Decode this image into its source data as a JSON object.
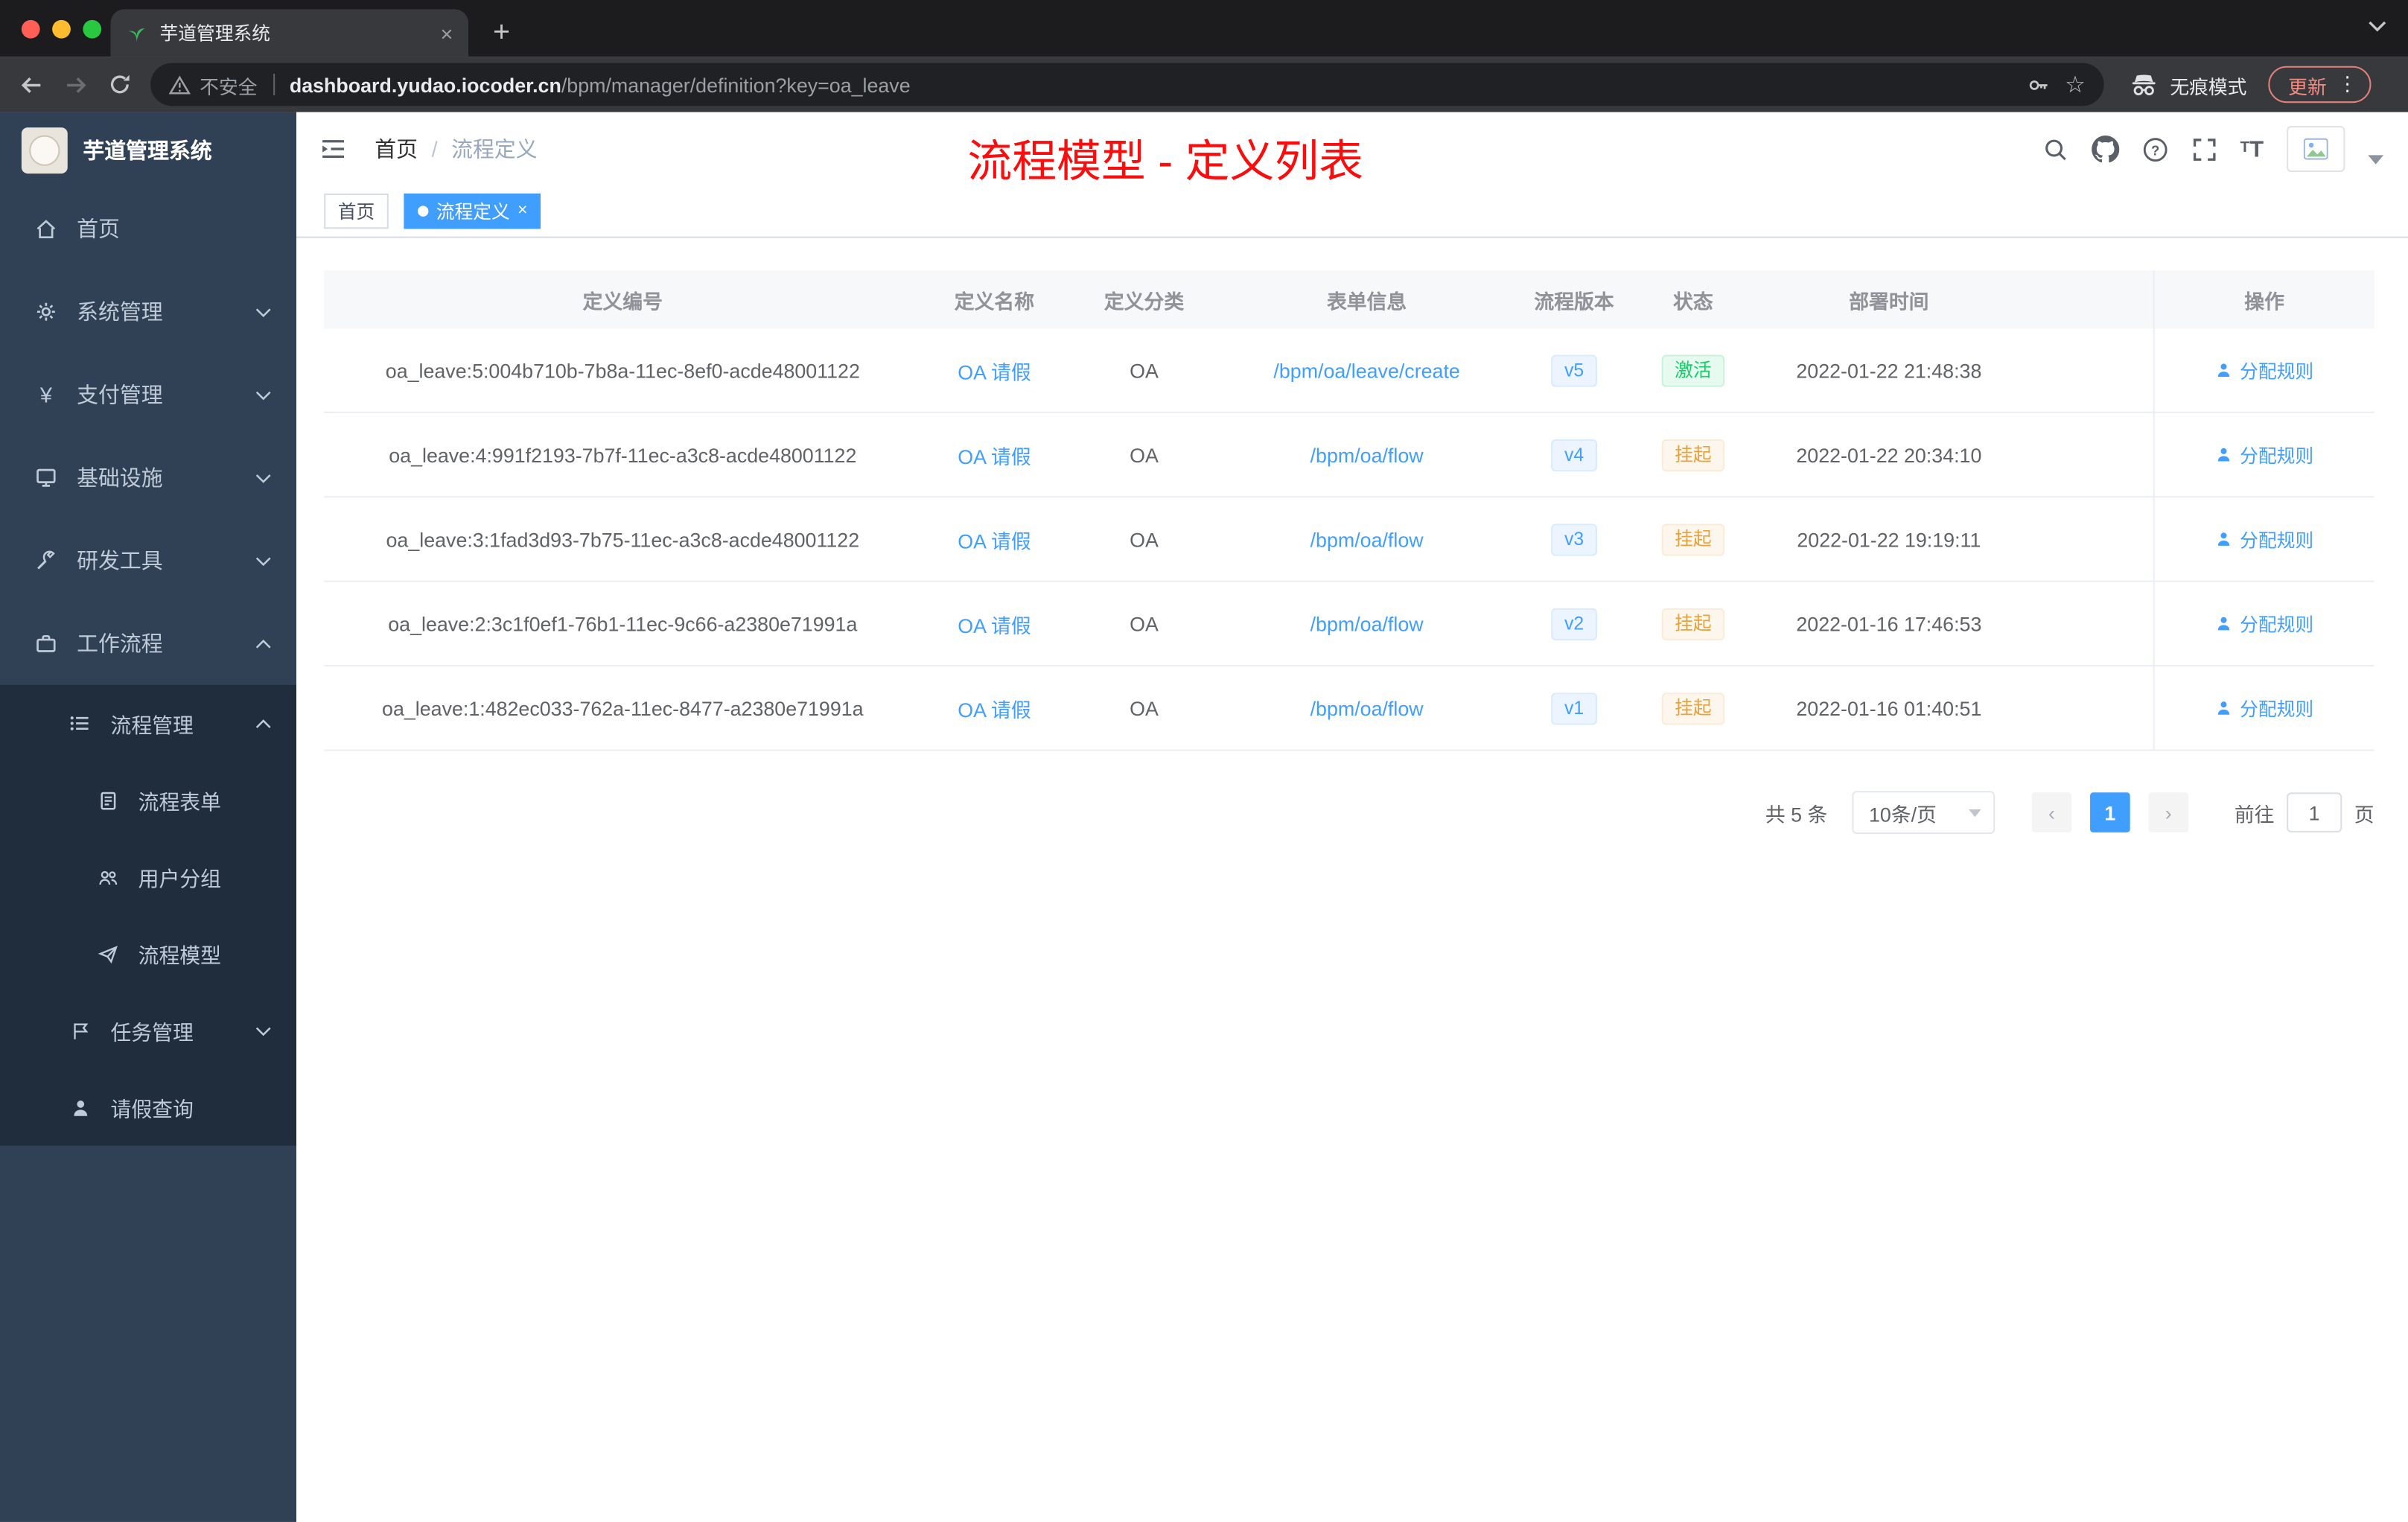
{
  "browser": {
    "tab_title": "芋道管理系统",
    "new_tab_label": "+",
    "strip_chevron": "ˇ",
    "address": {
      "security_label": "不安全",
      "domain": "dashboard.yudao.iocoder.cn",
      "path": "/bpm/manager/definition?key=oa_leave"
    },
    "incognito_label": "无痕模式",
    "update_label": "更新",
    "kebab": "⋮",
    "close_glyph": "×"
  },
  "sidebar": {
    "logo_title": "芋道管理系统",
    "menu": [
      {
        "label": "首页",
        "icon": "home-icon",
        "expandable": false
      },
      {
        "label": "系统管理",
        "icon": "gear-icon",
        "expandable": true
      },
      {
        "label": "支付管理",
        "icon": "yen-icon",
        "expandable": true
      },
      {
        "label": "基础设施",
        "icon": "monitor-icon",
        "expandable": true
      },
      {
        "label": "研发工具",
        "icon": "tools-icon",
        "expandable": true
      },
      {
        "label": "工作流程",
        "icon": "briefcase-icon",
        "expandable": true,
        "expanded": true
      }
    ],
    "submenu": [
      {
        "label": "流程管理",
        "icon": "list-icon",
        "expanded": true
      },
      {
        "label": "流程表单",
        "icon": "document-icon"
      },
      {
        "label": "用户分组",
        "icon": "users-icon"
      },
      {
        "label": "流程模型",
        "icon": "paper-plane-icon"
      },
      {
        "label": "任务管理",
        "icon": "flag-icon",
        "expandable": true
      },
      {
        "label": "请假查询",
        "icon": "person-icon"
      }
    ]
  },
  "navbar": {
    "breadcrumb": [
      "首页",
      "流程定义"
    ],
    "breadcrumb_sep": "/",
    "annotation": "流程模型 - 定义列表",
    "icons": [
      "search-icon",
      "github-icon",
      "question-icon",
      "fullscreen-icon",
      "fontsize-icon",
      "avatar",
      "caret-down-icon"
    ]
  },
  "tags": [
    {
      "label": "首页",
      "active": false
    },
    {
      "label": "流程定义",
      "active": true,
      "close": "×"
    }
  ],
  "table": {
    "columns": [
      "定义编号",
      "定义名称",
      "定义分类",
      "表单信息",
      "流程版本",
      "状态",
      "部署时间",
      "操作"
    ],
    "action_label": "分配规则",
    "rows": [
      {
        "id": "oa_leave:5:004b710b-7b8a-11ec-8ef0-acde48001122",
        "name": "OA 请假",
        "category": "OA",
        "form": "/bpm/oa/leave/create",
        "version": "v5",
        "status": "激活",
        "status_type": "active",
        "deployed_at": "2022-01-22 21:48:38"
      },
      {
        "id": "oa_leave:4:991f2193-7b7f-11ec-a3c8-acde48001122",
        "name": "OA 请假",
        "category": "OA",
        "form": "/bpm/oa/flow",
        "version": "v4",
        "status": "挂起",
        "status_type": "suspended",
        "deployed_at": "2022-01-22 20:34:10"
      },
      {
        "id": "oa_leave:3:1fad3d93-7b75-11ec-a3c8-acde48001122",
        "name": "OA 请假",
        "category": "OA",
        "form": "/bpm/oa/flow",
        "version": "v3",
        "status": "挂起",
        "status_type": "suspended",
        "deployed_at": "2022-01-22 19:19:11"
      },
      {
        "id": "oa_leave:2:3c1f0ef1-76b1-11ec-9c66-a2380e71991a",
        "name": "OA 请假",
        "category": "OA",
        "form": "/bpm/oa/flow",
        "version": "v2",
        "status": "挂起",
        "status_type": "suspended",
        "deployed_at": "2022-01-16 17:46:53"
      },
      {
        "id": "oa_leave:1:482ec033-762a-11ec-8477-a2380e71991a",
        "name": "OA 请假",
        "category": "OA",
        "form": "/bpm/oa/flow",
        "version": "v1",
        "status": "挂起",
        "status_type": "suspended",
        "deployed_at": "2022-01-16 01:40:51"
      }
    ]
  },
  "pagination": {
    "total": "共 5 条",
    "page_size": "10条/页",
    "prev": "‹",
    "next": "›",
    "current_page": "1",
    "goto_label": "前往",
    "goto_value": "1",
    "page_unit": "页"
  },
  "colors": {
    "accent": "#409eff",
    "sidebar_bg": "#304156",
    "submenu_bg": "#1f2d3d",
    "status_active": "#13ce66",
    "status_suspended": "#e6a23c",
    "annotation_red": "#fb0d0d",
    "tab_strip_bg": "#1c1c1f",
    "toolbar_bg": "#38393c"
  }
}
